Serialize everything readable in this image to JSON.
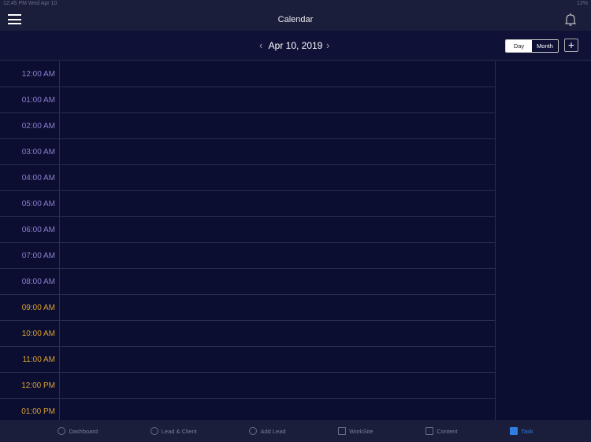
{
  "status": {
    "time": "12:45 PM  Wed Apr 10",
    "battery": "13%"
  },
  "header": {
    "title": "Calendar"
  },
  "datebar": {
    "date": "Apr 10, 2019",
    "prev": "‹",
    "next": "›",
    "view_day": "Day",
    "view_month": "Month",
    "add": "+"
  },
  "times": [
    {
      "label": "12:00 AM",
      "color": "#8a7fd0"
    },
    {
      "label": "01:00 AM",
      "color": "#8a7fd0"
    },
    {
      "label": "02:00 AM",
      "color": "#8a7fd0"
    },
    {
      "label": "03:00 AM",
      "color": "#8a7fd0"
    },
    {
      "label": "04:00 AM",
      "color": "#8a7fd0"
    },
    {
      "label": "05:00 AM",
      "color": "#8a7fd0"
    },
    {
      "label": "06:00 AM",
      "color": "#8a7fd0"
    },
    {
      "label": "07:00 AM",
      "color": "#8a7fd0"
    },
    {
      "label": "08:00 AM",
      "color": "#8a7fd0"
    },
    {
      "label": "09:00 AM",
      "color": "#d9a030"
    },
    {
      "label": "10:00 AM",
      "color": "#d9a030"
    },
    {
      "label": "11:00 AM",
      "color": "#d9a030"
    },
    {
      "label": "12:00 PM",
      "color": "#d9a030"
    },
    {
      "label": "01:00 PM",
      "color": "#d9a030"
    }
  ],
  "tabs": [
    {
      "label": "Dashboard"
    },
    {
      "label": "Lead & Client"
    },
    {
      "label": "Add Lead"
    },
    {
      "label": "WorkSite"
    },
    {
      "label": "Content"
    },
    {
      "label": "Task"
    }
  ]
}
